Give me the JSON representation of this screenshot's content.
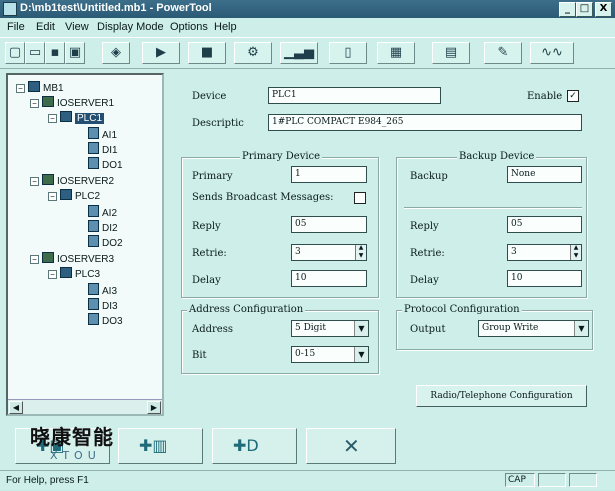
{
  "window": {
    "title": "D:\\mb1test\\Untitled.mb1 - PowerTool",
    "min": "_",
    "max": "□",
    "close": "X"
  },
  "menu": [
    "File",
    "Edit",
    "View",
    "Display Mode",
    "Options",
    "Help"
  ],
  "toolbar": {
    "icons": [
      "new-file-icon",
      "open-folder-icon",
      "save-icon",
      "save-as-icon",
      "print-icon",
      "run-icon",
      "stop-icon",
      "tools-icon",
      "chart-icon",
      "module-icon",
      "grid-icon",
      "plc-icon",
      "wrench-icon",
      "signal-icon"
    ]
  },
  "tree": {
    "root": "MB1",
    "servers": [
      {
        "name": "IOSERVER1",
        "plc": "PLC1",
        "items": [
          "AI1",
          "DI1",
          "DO1"
        ]
      },
      {
        "name": "IOSERVER2",
        "plc": "PLC2",
        "items": [
          "AI2",
          "DI2",
          "DO2"
        ]
      },
      {
        "name": "IOSERVER3",
        "plc": "PLC3",
        "items": [
          "AI3",
          "DI3",
          "DO3"
        ]
      }
    ]
  },
  "device": {
    "label": "Device",
    "value": "PLC1",
    "enable_label": "Enable",
    "enable_check": "✓"
  },
  "description": {
    "label": "Descriptic",
    "value": "1#PLC COMPACT E984_265"
  },
  "primary": {
    "title": "Primary Device",
    "primary_label": "Primary",
    "primary_value": "1",
    "broadcast_label": "Sends Broadcast Messages:",
    "reply_label": "Reply",
    "reply_value": "05",
    "retries_label": "Retrie:",
    "retries_value": "3",
    "delay_label": "Delay",
    "delay_value": "10"
  },
  "backup": {
    "title": "Backup Device",
    "backup_label": "Backup",
    "backup_value": "None",
    "reply_label": "Reply",
    "reply_value": "05",
    "retries_label": "Retrie:",
    "retries_value": "3",
    "delay_label": "Delay",
    "delay_value": "10"
  },
  "address": {
    "title": "Address Configuration",
    "address_label": "Address",
    "address_value": "5 Digit",
    "bit_label": "Bit",
    "bit_value": "0-15"
  },
  "protocol": {
    "title": "Protocol Configuration",
    "output_label": "Output",
    "output_value": "Group Write"
  },
  "radio_button": "Radio/Telephone Configuration",
  "status": {
    "text": "For Help, press F1",
    "cap": "CAP"
  },
  "watermark": {
    "cn": "晓康智能",
    "en": "XTOU"
  }
}
